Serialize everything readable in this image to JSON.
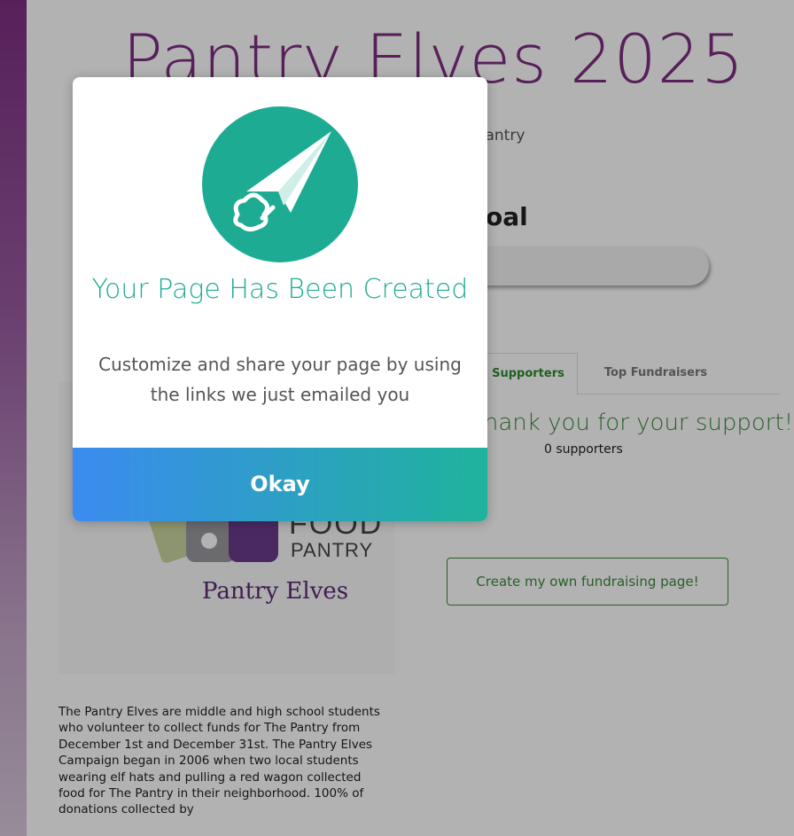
{
  "page": {
    "title": "Pantry Elves 2025",
    "subtitle": "Pantry",
    "goal_heading": "Goal",
    "tabs": [
      "Supporters",
      "Top Fundraisers"
    ],
    "thanks": "Thank you for your support!",
    "supporters_count": "0 supporters",
    "create_button": "Create my own fundraising page!",
    "logo": {
      "food_text": "FOOD",
      "pantry_text": "PANTRY",
      "org_name": "Pantry Elves"
    },
    "description": "The Pantry Elves are middle and high school students who volunteer to collect funds for The Pantry from December 1st and December 31st. The Pantry Elves Campaign began in 2006 when two local students wearing elf hats and pulling a red wagon collected food for The Pantry in their neighborhood. 100% of donations collected by"
  },
  "modal": {
    "icon": "paper-plane-icon",
    "title": "Your Page Has Been Created",
    "message": "Customize and share your page by using the links we just emailed you",
    "button": "Okay"
  },
  "colors": {
    "brand_purple": "#7d2f82",
    "accent_teal": "#1eab93",
    "button_blue": "#3b8bf0",
    "supporter_green": "#3a8a3a"
  }
}
